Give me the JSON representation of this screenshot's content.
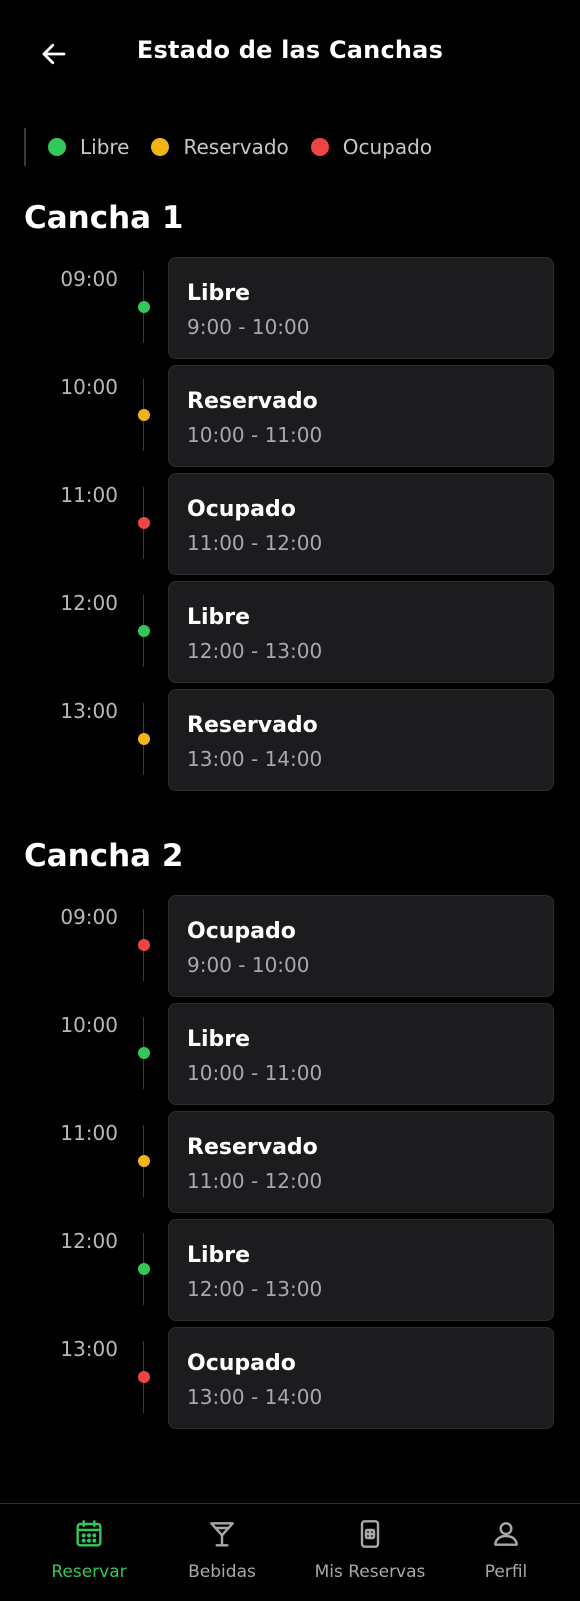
{
  "header": {
    "title": "Estado de las Canchas"
  },
  "legend": [
    {
      "label": "Libre",
      "color": "#34c759"
    },
    {
      "label": "Reservado",
      "color": "#f0b514"
    },
    {
      "label": "Ocupado",
      "color": "#ef4444"
    }
  ],
  "courts": [
    {
      "name": "Cancha 1",
      "slots": [
        {
          "time": "09:00",
          "status": "Libre",
          "range": "9:00 - 10:00"
        },
        {
          "time": "10:00",
          "status": "Reservado",
          "range": "10:00 - 11:00"
        },
        {
          "time": "11:00",
          "status": "Ocupado",
          "range": "11:00 - 12:00"
        },
        {
          "time": "12:00",
          "status": "Libre",
          "range": "12:00 - 13:00"
        },
        {
          "time": "13:00",
          "status": "Reservado",
          "range": "13:00 - 14:00"
        }
      ]
    },
    {
      "name": "Cancha 2",
      "slots": [
        {
          "time": "09:00",
          "status": "Ocupado",
          "range": "9:00 - 10:00"
        },
        {
          "time": "10:00",
          "status": "Libre",
          "range": "10:00 - 11:00"
        },
        {
          "time": "11:00",
          "status": "Reservado",
          "range": "11:00 - 12:00"
        },
        {
          "time": "12:00",
          "status": "Libre",
          "range": "12:00 - 13:00"
        },
        {
          "time": "13:00",
          "status": "Ocupado",
          "range": "13:00 - 14:00"
        }
      ]
    }
  ],
  "nav": [
    {
      "label": "Reservar",
      "icon": "calendar-icon",
      "active": true
    },
    {
      "label": "Bebidas",
      "icon": "cocktail-icon",
      "active": false
    },
    {
      "label": "Mis Reservas",
      "icon": "ticket-icon",
      "active": false
    },
    {
      "label": "Perfil",
      "icon": "user-icon",
      "active": false
    }
  ],
  "colors": {
    "libre": "#34c759",
    "reservado": "#f0b514",
    "ocupado": "#ef4444",
    "active_nav": "#34c759"
  }
}
